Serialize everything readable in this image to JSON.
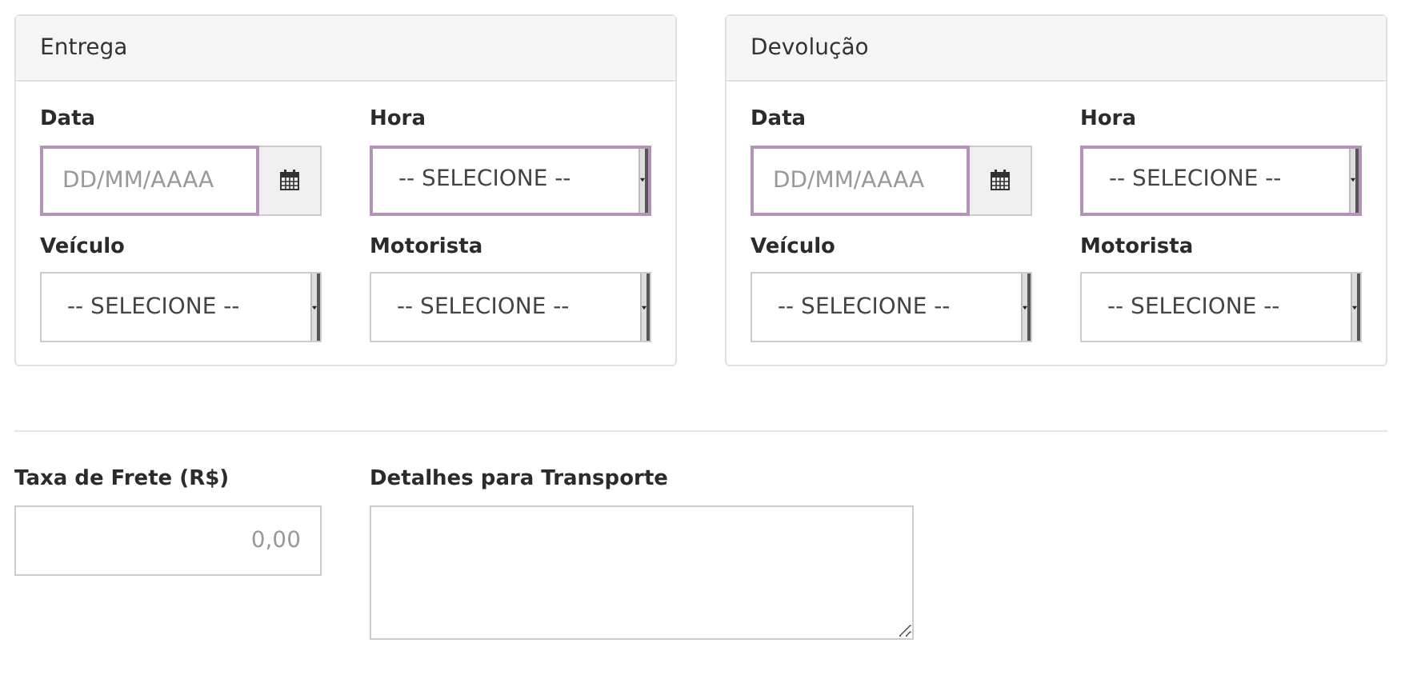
{
  "panels": [
    {
      "title": "Entrega",
      "date": {
        "label": "Data",
        "placeholder": "DD/MM/AAAA",
        "highlighted": true
      },
      "selects": [
        {
          "label": "Hora",
          "value": "-- SELECIONE --",
          "highlighted": true
        },
        {
          "label": "Veículo",
          "value": "-- SELECIONE --",
          "highlighted": false
        },
        {
          "label": "Motorista",
          "value": "-- SELECIONE --",
          "highlighted": false
        }
      ]
    },
    {
      "title": "Devolução",
      "date": {
        "label": "Data",
        "placeholder": "DD/MM/AAAA",
        "highlighted": true
      },
      "selects": [
        {
          "label": "Hora",
          "value": "-- SELECIONE --",
          "highlighted": true
        },
        {
          "label": "Veículo",
          "value": "-- SELECIONE --",
          "highlighted": false
        },
        {
          "label": "Motorista",
          "value": "-- SELECIONE --",
          "highlighted": false
        }
      ]
    }
  ],
  "freight": {
    "label": "Taxa de Frete (R$)",
    "placeholder": "0,00"
  },
  "details": {
    "label": "Detalhes para Transporte"
  }
}
